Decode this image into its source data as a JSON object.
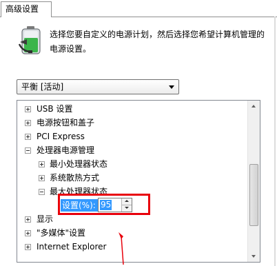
{
  "tab": {
    "label": "高级设置"
  },
  "intro": {
    "text": "选择您要自定义的电源计划，然后选择您希望计算机管理的电源设置。"
  },
  "plan_select": {
    "value": "平衡 [活动]"
  },
  "tree": {
    "items": [
      {
        "label": "USB 设置",
        "expander": "plus"
      },
      {
        "label": "电源按钮和盖子",
        "expander": "plus"
      },
      {
        "label": "PCI Express",
        "expander": "plus"
      },
      {
        "label": "处理器电源管理",
        "expander": "minus"
      },
      {
        "label": "最小处理器状态",
        "expander": "plus"
      },
      {
        "label": "系统散热方式",
        "expander": "plus"
      },
      {
        "label": "最大处理器状态",
        "expander": "minus"
      },
      {
        "label": "显示",
        "expander": "plus"
      },
      {
        "label": "\"多媒体\"设置",
        "expander": "plus"
      },
      {
        "label": "Internet Explorer",
        "expander": "plus"
      }
    ],
    "setting": {
      "label": "设置(%):",
      "value": "95"
    }
  },
  "colors": {
    "highlight": "#e8000b",
    "selection": "#3399ff"
  }
}
